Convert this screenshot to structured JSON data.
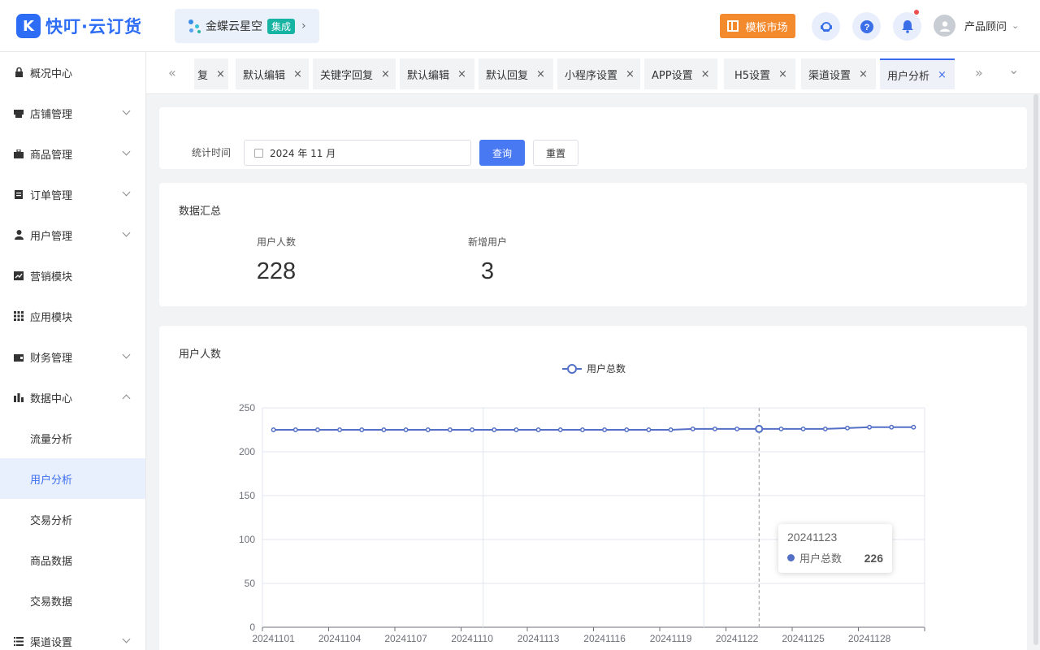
{
  "header": {
    "logo_mark": "K",
    "logo_text": "快叮·云订货",
    "integration": {
      "name": "金蝶云星空",
      "badge": "集成",
      "arrow": "›"
    },
    "template_market": "模板市场",
    "user_name": "产品顾问",
    "icons": [
      "customer-service-icon",
      "help-icon",
      "bell-icon",
      "avatar-icon"
    ]
  },
  "sidebar": {
    "items": [
      {
        "label": "概况中心",
        "icon": "lock-icon",
        "glyph": "🔒",
        "expandable": false
      },
      {
        "label": "店铺管理",
        "icon": "store-icon",
        "glyph": "▬",
        "expandable": true
      },
      {
        "label": "商品管理",
        "icon": "briefcase-icon",
        "glyph": "▬",
        "expandable": true
      },
      {
        "label": "订单管理",
        "icon": "clipboard-icon",
        "glyph": "▤",
        "expandable": true
      },
      {
        "label": "用户管理",
        "icon": "user-icon",
        "glyph": "●",
        "expandable": true
      },
      {
        "label": "营销模块",
        "icon": "trend-icon",
        "glyph": "◪",
        "expandable": false
      },
      {
        "label": "应用模块",
        "icon": "grid-icon",
        "glyph": "▦",
        "expandable": false
      },
      {
        "label": "财务管理",
        "icon": "wallet-icon",
        "glyph": "▣",
        "expandable": true
      },
      {
        "label": "数据中心",
        "icon": "bar-chart-icon",
        "glyph": "▮",
        "expandable": true,
        "expanded": true
      },
      {
        "label": "渠道设置",
        "icon": "list-icon",
        "glyph": "☰",
        "expandable": true
      }
    ],
    "data_center_children": [
      "流量分析",
      "用户分析",
      "交易分析",
      "商品数据",
      "交易数据"
    ],
    "active_child": "用户分析"
  },
  "tabs": {
    "items": [
      {
        "label": "复",
        "closable": true
      },
      {
        "label": "默认编辑",
        "closable": true
      },
      {
        "label": "关键字回复",
        "closable": true
      },
      {
        "label": "默认编辑",
        "closable": true
      },
      {
        "label": "默认回复",
        "closable": true
      },
      {
        "label": "小程序设置",
        "closable": true
      },
      {
        "label": "APP设置",
        "closable": true
      },
      {
        "label": "H5设置",
        "closable": true
      },
      {
        "label": "渠道设置",
        "closable": true
      },
      {
        "label": "用户分析",
        "closable": true,
        "active": true
      }
    ],
    "close_glyph": "×",
    "prev_glyph": "«",
    "next_glyph": "»",
    "more_glyph": "⌄"
  },
  "filter": {
    "label": "统计时间",
    "date_value": "2024 年 11 月",
    "query_button": "查询",
    "reset_button": "重置"
  },
  "summary": {
    "title": "数据汇总",
    "stats": [
      {
        "label": "用户人数",
        "value": "228"
      },
      {
        "label": "新增用户",
        "value": "3"
      }
    ]
  },
  "chart_card": {
    "title": "用户人数"
  },
  "colors": {
    "primary": "#4978f3",
    "series": "#5470c6",
    "orange": "#f48a2e",
    "teal": "#17b3a3"
  },
  "chart_data": {
    "type": "line",
    "title": "用户人数",
    "legend": [
      "用户总数"
    ],
    "legend_position": "top-center",
    "x": [
      "20241101",
      "20241102",
      "20241103",
      "20241104",
      "20241105",
      "20241106",
      "20241107",
      "20241108",
      "20241109",
      "20241110",
      "20241111",
      "20241112",
      "20241113",
      "20241114",
      "20241115",
      "20241116",
      "20241117",
      "20241118",
      "20241119",
      "20241120",
      "20241121",
      "20241122",
      "20241123",
      "20241124",
      "20241125",
      "20241126",
      "20241127",
      "20241128",
      "20241129",
      "20241130"
    ],
    "x_tick_labels": [
      "20241101",
      "20241104",
      "20241107",
      "20241110",
      "20241113",
      "20241116",
      "20241119",
      "20241122",
      "20241125",
      "20241128"
    ],
    "series": [
      {
        "name": "用户总数",
        "values": [
          225,
          225,
          225,
          225,
          225,
          225,
          225,
          225,
          225,
          225,
          225,
          225,
          225,
          225,
          225,
          225,
          225,
          225,
          225,
          226,
          226,
          226,
          226,
          226,
          226,
          226,
          227,
          228,
          228,
          228
        ]
      }
    ],
    "ylim": [
      0,
      250
    ],
    "y_ticks": [
      0,
      50,
      100,
      150,
      200,
      250
    ],
    "grid": true,
    "tooltip": {
      "title": "20241123",
      "series": "用户总数",
      "value": "226"
    }
  }
}
